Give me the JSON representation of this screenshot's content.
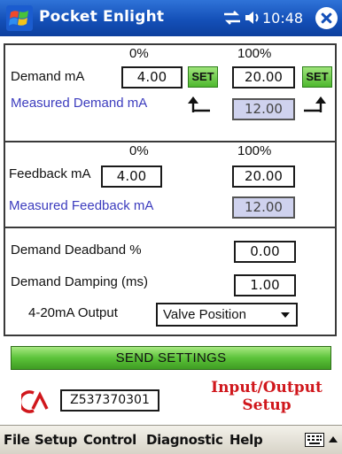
{
  "titlebar": {
    "app_title": "Pocket Enlight",
    "clock": "10:48",
    "icons": [
      "windows-start-icon",
      "connectivity-icon",
      "volume-icon",
      "close-icon"
    ]
  },
  "demand_panel": {
    "pct_low": "0%",
    "pct_high": "100%",
    "demand_label": "Demand mA",
    "demand_low": "4.00",
    "demand_high": "20.00",
    "set_label": "SET",
    "measured_label": "Measured Demand mA",
    "measured_value": "12.00"
  },
  "feedback_panel": {
    "pct_low": "0%",
    "pct_high": "100%",
    "feedback_label": "Feedback mA",
    "feedback_low": "4.00",
    "feedback_high": "20.00",
    "measured_label": "Measured Feedback mA",
    "measured_value": "12.00"
  },
  "settings_panel": {
    "deadband_label": "Demand Deadband %",
    "deadband_value": "0.00",
    "damping_label": "Demand Damping (ms)",
    "damping_value": "1.00",
    "output_label": "4-20mA Output",
    "output_selected": "Valve Position"
  },
  "send_button": "SEND SETTINGS",
  "footer": {
    "serial": "Z537370301",
    "page_title_line1": "Input/Output",
    "page_title_line2": "Setup"
  },
  "menubar": {
    "items": [
      "File",
      "Setup",
      "Control",
      "Diagnostic",
      "Help"
    ]
  },
  "colors": {
    "titlebar": "#1450b8",
    "accent_green": "#5cc33a",
    "label_blue": "#3c3cbe",
    "title_red": "#d0171c",
    "readonly_field": "#cfd2ee"
  }
}
